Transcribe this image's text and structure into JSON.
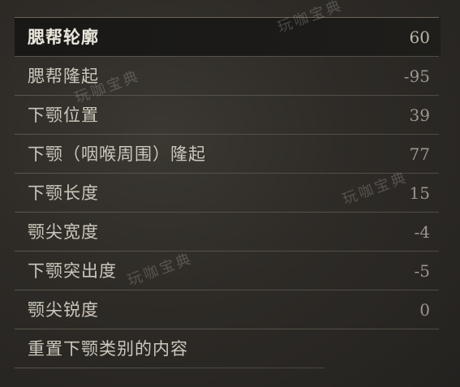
{
  "rows": [
    {
      "label": "腮帮轮廓",
      "value": "60"
    },
    {
      "label": "腮帮隆起",
      "value": "-95"
    },
    {
      "label": "下颚位置",
      "value": "39"
    },
    {
      "label": "下颚（咽喉周围）隆起",
      "value": "77"
    },
    {
      "label": "下颚长度",
      "value": "15"
    },
    {
      "label": "颚尖宽度",
      "value": "-4"
    },
    {
      "label": "下颚突出度",
      "value": "-5"
    },
    {
      "label": "颚尖锐度",
      "value": "0"
    }
  ],
  "reset_label": "重置下颚类别的内容",
  "watermark": "玩咖宝典"
}
